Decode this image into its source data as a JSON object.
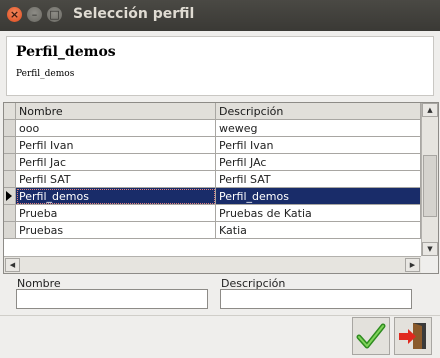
{
  "window": {
    "title": "Selección perfil"
  },
  "header": {
    "title": "Perfil_demos",
    "subtitle": "Perfil_demos"
  },
  "grid": {
    "columns": [
      "Nombre",
      "Descripción"
    ],
    "rows": [
      [
        "ooo",
        "weweg"
      ],
      [
        "Perfil Ivan",
        "Perfil Ivan"
      ],
      [
        "Perfil Jac",
        "Perfil JAc"
      ],
      [
        "Perfil SAT",
        "Perfil SAT"
      ],
      [
        "Perfil_demos",
        "Perfil_demos"
      ],
      [
        "Prueba",
        "Pruebas de Katia"
      ],
      [
        "Pruebas",
        "Katia"
      ]
    ],
    "selected_row": "Perfil_demos"
  },
  "filters": {
    "name_label": "Nombre",
    "name_value": "",
    "desc_label": "Descripción",
    "desc_value": ""
  },
  "buttons": {
    "accept_icon": "check-icon",
    "exit_icon": "exit-door-icon"
  },
  "colors": {
    "selection": "#192c69",
    "titlebar": "#3c3b37",
    "close_button": "#e9541f"
  }
}
